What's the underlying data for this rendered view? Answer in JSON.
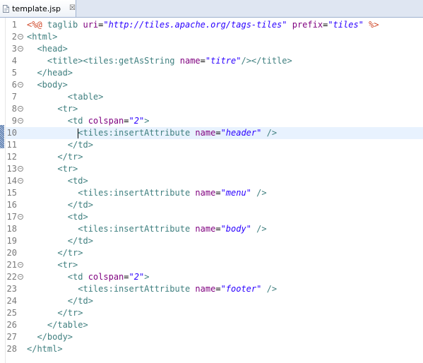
{
  "tab": {
    "title": "template.jsp",
    "close_symbol": "☒"
  },
  "colors": {
    "delimiter": "#d04a2b",
    "tag": "#3f7f7f",
    "attribute": "#7f007f",
    "value": "#2a00ff",
    "current_line": "#e8f2fe"
  },
  "code_lines": [
    {
      "n": "1",
      "fold": false,
      "current": false,
      "indent": 0,
      "tokens": [
        [
          "delim",
          "<%@ "
        ],
        [
          "kw",
          "taglib "
        ],
        [
          "attr",
          "uri"
        ],
        [
          "text",
          "="
        ],
        [
          "val",
          "\"http://tiles.apache.org/tags-tiles\""
        ],
        [
          "text",
          " "
        ],
        [
          "attr",
          "prefix"
        ],
        [
          "text",
          "="
        ],
        [
          "val",
          "\"tiles\""
        ],
        [
          "text",
          " "
        ],
        [
          "delim",
          "%>"
        ]
      ]
    },
    {
      "n": "2",
      "fold": true,
      "current": false,
      "indent": 0,
      "tokens": [
        [
          "tag",
          "<html>"
        ]
      ]
    },
    {
      "n": "3",
      "fold": true,
      "current": false,
      "indent": 2,
      "tokens": [
        [
          "tag",
          "<head>"
        ]
      ]
    },
    {
      "n": "4",
      "fold": false,
      "current": false,
      "indent": 4,
      "tokens": [
        [
          "tag",
          "<title><tiles:getAsString "
        ],
        [
          "attr",
          "name"
        ],
        [
          "text",
          "="
        ],
        [
          "val",
          "\"titre\""
        ],
        [
          "tag",
          "/></title>"
        ]
      ]
    },
    {
      "n": "5",
      "fold": false,
      "current": false,
      "indent": 2,
      "tokens": [
        [
          "tag",
          "</head>"
        ]
      ]
    },
    {
      "n": "6",
      "fold": true,
      "current": false,
      "indent": 2,
      "tokens": [
        [
          "tag",
          "<body>"
        ]
      ]
    },
    {
      "n": "7",
      "fold": false,
      "current": false,
      "indent": 8,
      "tokens": [
        [
          "tag",
          "<table>"
        ]
      ]
    },
    {
      "n": "8",
      "fold": true,
      "current": false,
      "indent": 6,
      "tokens": [
        [
          "tag",
          "<tr>"
        ]
      ]
    },
    {
      "n": "9",
      "fold": true,
      "current": false,
      "indent": 8,
      "tokens": [
        [
          "tag",
          "<td "
        ],
        [
          "attr",
          "colspan"
        ],
        [
          "text",
          "="
        ],
        [
          "val",
          "\"2\""
        ],
        [
          "tag",
          ">"
        ]
      ]
    },
    {
      "n": "10",
      "fold": false,
      "current": true,
      "indent": 10,
      "tokens": [
        [
          "cursor",
          ""
        ],
        [
          "tag",
          "<tiles:insertAttribute "
        ],
        [
          "attr",
          "name"
        ],
        [
          "text",
          "="
        ],
        [
          "val",
          "\"header\""
        ],
        [
          "text",
          " "
        ],
        [
          "tag",
          "/>"
        ]
      ]
    },
    {
      "n": "11",
      "fold": false,
      "current": false,
      "indent": 8,
      "tokens": [
        [
          "tag",
          "</td>"
        ]
      ]
    },
    {
      "n": "12",
      "fold": false,
      "current": false,
      "indent": 6,
      "tokens": [
        [
          "tag",
          "</tr>"
        ]
      ]
    },
    {
      "n": "13",
      "fold": true,
      "current": false,
      "indent": 6,
      "tokens": [
        [
          "tag",
          "<tr>"
        ]
      ]
    },
    {
      "n": "14",
      "fold": true,
      "current": false,
      "indent": 8,
      "tokens": [
        [
          "tag",
          "<td>"
        ]
      ]
    },
    {
      "n": "15",
      "fold": false,
      "current": false,
      "indent": 10,
      "tokens": [
        [
          "tag",
          "<tiles:insertAttribute "
        ],
        [
          "attr",
          "name"
        ],
        [
          "text",
          "="
        ],
        [
          "val",
          "\"menu\""
        ],
        [
          "text",
          " "
        ],
        [
          "tag",
          "/>"
        ]
      ]
    },
    {
      "n": "16",
      "fold": false,
      "current": false,
      "indent": 8,
      "tokens": [
        [
          "tag",
          "</td>"
        ]
      ]
    },
    {
      "n": "17",
      "fold": true,
      "current": false,
      "indent": 8,
      "tokens": [
        [
          "tag",
          "<td>"
        ]
      ]
    },
    {
      "n": "18",
      "fold": false,
      "current": false,
      "indent": 10,
      "tokens": [
        [
          "tag",
          "<tiles:insertAttribute "
        ],
        [
          "attr",
          "name"
        ],
        [
          "text",
          "="
        ],
        [
          "val",
          "\"body\""
        ],
        [
          "text",
          " "
        ],
        [
          "tag",
          "/>"
        ]
      ]
    },
    {
      "n": "19",
      "fold": false,
      "current": false,
      "indent": 8,
      "tokens": [
        [
          "tag",
          "</td>"
        ]
      ]
    },
    {
      "n": "20",
      "fold": false,
      "current": false,
      "indent": 6,
      "tokens": [
        [
          "tag",
          "</tr>"
        ]
      ]
    },
    {
      "n": "21",
      "fold": true,
      "current": false,
      "indent": 6,
      "tokens": [
        [
          "tag",
          "<tr>"
        ]
      ]
    },
    {
      "n": "22",
      "fold": true,
      "current": false,
      "indent": 8,
      "tokens": [
        [
          "tag",
          "<td "
        ],
        [
          "attr",
          "colspan"
        ],
        [
          "text",
          "="
        ],
        [
          "val",
          "\"2\""
        ],
        [
          "tag",
          ">"
        ]
      ]
    },
    {
      "n": "23",
      "fold": false,
      "current": false,
      "indent": 10,
      "tokens": [
        [
          "tag",
          "<tiles:insertAttribute "
        ],
        [
          "attr",
          "name"
        ],
        [
          "text",
          "="
        ],
        [
          "val",
          "\"footer\""
        ],
        [
          "text",
          " "
        ],
        [
          "tag",
          "/>"
        ]
      ]
    },
    {
      "n": "24",
      "fold": false,
      "current": false,
      "indent": 8,
      "tokens": [
        [
          "tag",
          "</td>"
        ]
      ]
    },
    {
      "n": "25",
      "fold": false,
      "current": false,
      "indent": 6,
      "tokens": [
        [
          "tag",
          "</tr>"
        ]
      ]
    },
    {
      "n": "26",
      "fold": false,
      "current": false,
      "indent": 4,
      "tokens": [
        [
          "tag",
          "</table>"
        ]
      ]
    },
    {
      "n": "27",
      "fold": false,
      "current": false,
      "indent": 2,
      "tokens": [
        [
          "tag",
          "</body>"
        ]
      ]
    },
    {
      "n": "28",
      "fold": false,
      "current": false,
      "indent": 0,
      "tokens": [
        [
          "tag",
          "</html>"
        ]
      ]
    }
  ]
}
